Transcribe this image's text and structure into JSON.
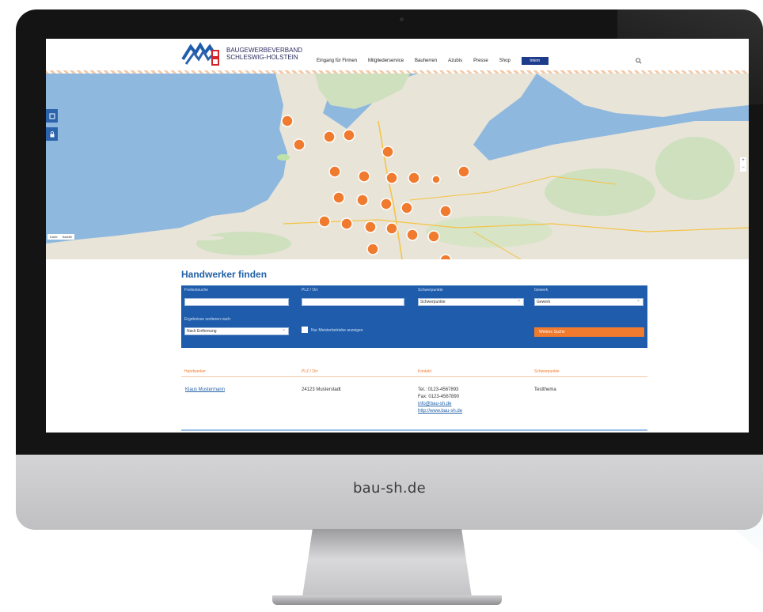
{
  "domain_label": "bau-sh.de",
  "header": {
    "logo_line1": "BAUGEWERBEVERBAND",
    "logo_line2": "SCHLESWIG-HOLSTEIN",
    "nav": [
      "Eingang für Firmen",
      "Mitgliederservice",
      "Bauherren",
      "Azubis",
      "Presse",
      "Shop"
    ],
    "nav_badge": "Intern",
    "colors": {
      "brand_blue": "#1f5cab",
      "accent_orange": "#f07a2e",
      "title_blue": "#2160a8"
    }
  },
  "map": {
    "type_buttons": [
      "Karte",
      "Satellit"
    ],
    "zoom": [
      "+",
      "−"
    ],
    "side_icons": [
      "login-icon",
      "lock-icon"
    ]
  },
  "page_title": "Handwerker finden",
  "search": {
    "freetext_label": "Freitextsuche",
    "freetext_value": "",
    "zip_label": "PLZ / Ort",
    "zip_value": "",
    "focus_label": "Schwerpunkte",
    "focus_value": "Schwerpunkte",
    "trade_label": "Gewerk",
    "trade_value": "Gewerk",
    "sort_label": "Ergebnisse sortieren nach",
    "sort_value": "Nach Entfernung",
    "checkbox_label": "Nur Meisterbetriebe anzeigen",
    "button_label": "Weitere Suche"
  },
  "results": {
    "columns": [
      "Handwerker",
      "PLZ / Ort",
      "Kontakt",
      "Schwerpunkte"
    ],
    "rows": [
      {
        "name": "Klaus Mustermann",
        "place": "24123 Musterstadt",
        "tel": "Tel.: 0123-4567893",
        "fax": "Fax: 0123-4567890",
        "email": "info@bau-sh.de",
        "web": "http://www.bau-sh.de",
        "focus": "Testthema"
      }
    ]
  }
}
